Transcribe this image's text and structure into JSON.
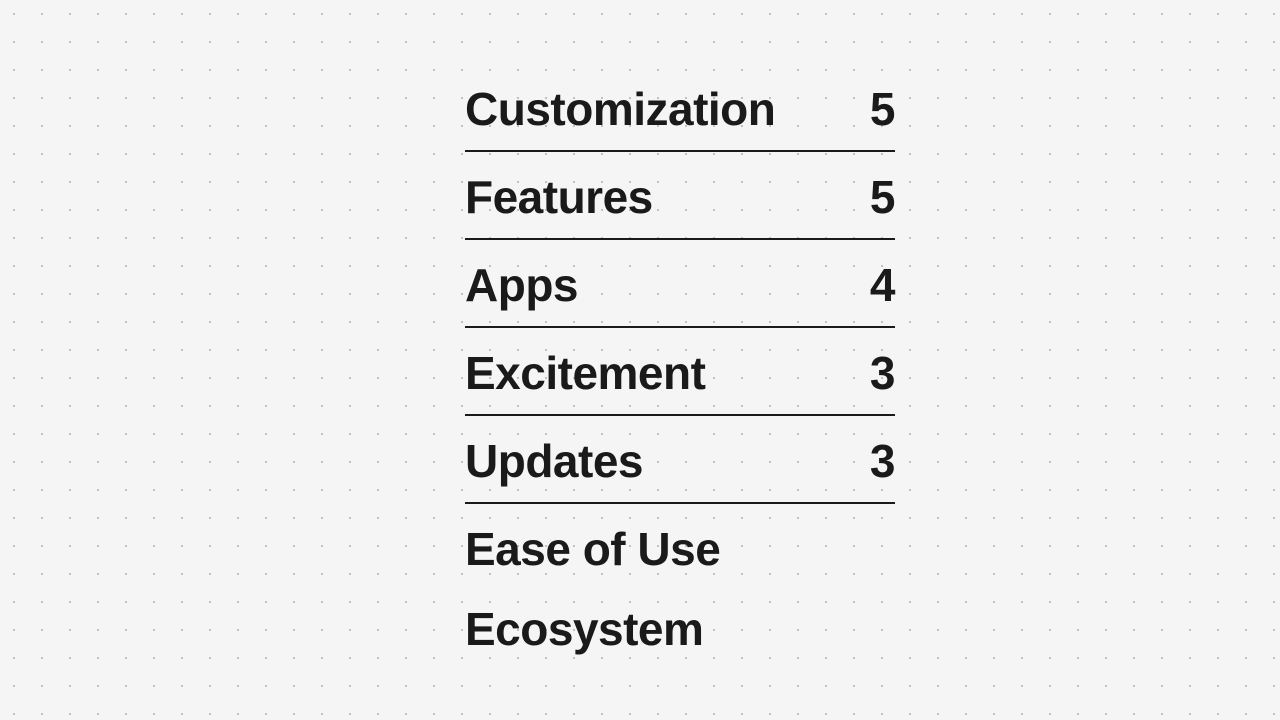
{
  "items": [
    {
      "label": "Customization",
      "score": "5",
      "hasScore": true
    },
    {
      "label": "Features",
      "score": "5",
      "hasScore": true
    },
    {
      "label": "Apps",
      "score": "4",
      "hasScore": true
    },
    {
      "label": "Excitement",
      "score": "3",
      "hasScore": true
    },
    {
      "label": "Updates",
      "score": "3",
      "hasScore": true
    },
    {
      "label": "Ease of Use",
      "score": null,
      "hasScore": false
    },
    {
      "label": "Ecosystem",
      "score": null,
      "hasScore": false
    }
  ]
}
